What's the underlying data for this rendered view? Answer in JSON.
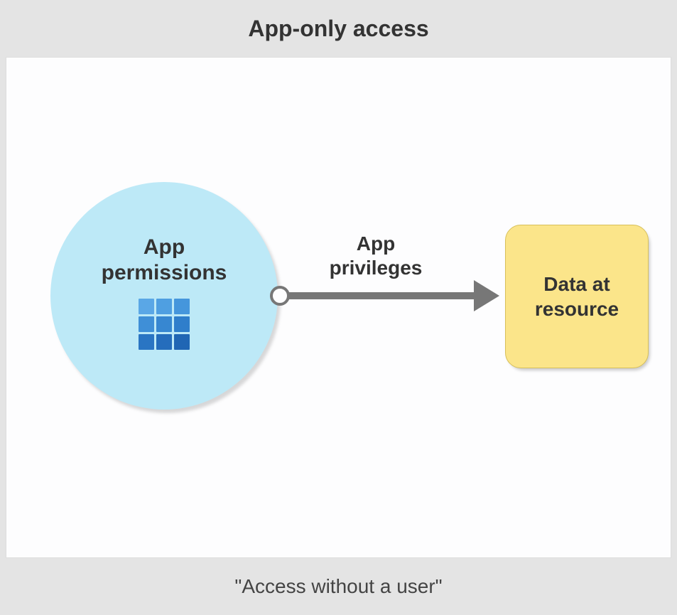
{
  "title": "App-only access",
  "footer": "\"Access without a user\"",
  "nodes": {
    "app_permissions": {
      "line1": "App",
      "line2": "permissions",
      "icon": "app-grid-icon"
    },
    "resource": {
      "line1": "Data at",
      "line2": "resource"
    }
  },
  "edge": {
    "line1": "App",
    "line2": "privileges"
  },
  "colors": {
    "circle_fill": "#bde9f7",
    "resource_fill": "#fbe58a",
    "arrow": "#777777",
    "page_bg": "#e4e4e4"
  }
}
